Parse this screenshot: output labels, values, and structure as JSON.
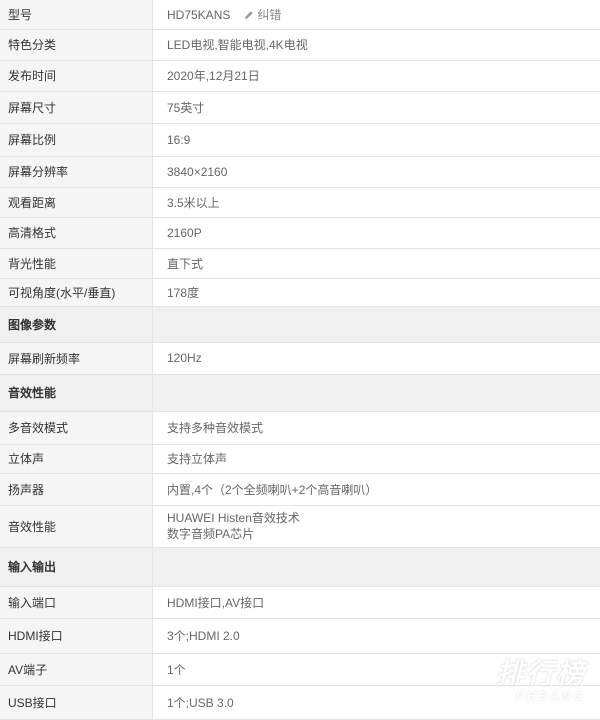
{
  "edit_link": {
    "label": "纠错",
    "icon": "pencil-icon"
  },
  "rows": [
    {
      "type": "row",
      "key": "型号",
      "values": [
        "HD75KANS"
      ],
      "edit": true
    },
    {
      "type": "row",
      "key": "特色分类",
      "values": [
        "LED电视,智能电视,4K电视"
      ]
    },
    {
      "type": "row",
      "key": "发布时间",
      "values": [
        "2020年,12月21日"
      ]
    },
    {
      "type": "row",
      "key": "屏幕尺寸",
      "values": [
        "75英寸"
      ]
    },
    {
      "type": "row",
      "key": "屏幕比例",
      "values": [
        "16:9"
      ]
    },
    {
      "type": "row",
      "key": "屏幕分辨率",
      "values": [
        "3840×2160"
      ]
    },
    {
      "type": "row",
      "key": "观看距离",
      "values": [
        "3.5米以上"
      ]
    },
    {
      "type": "row",
      "key": "高清格式",
      "values": [
        "2160P"
      ]
    },
    {
      "type": "row",
      "key": "背光性能",
      "values": [
        "直下式"
      ]
    },
    {
      "type": "row",
      "key": "可视角度(水平/垂直)",
      "values": [
        "178度"
      ]
    },
    {
      "type": "section",
      "key": "图像参数"
    },
    {
      "type": "row",
      "key": "屏幕刷新频率",
      "values": [
        "120Hz"
      ]
    },
    {
      "type": "section",
      "key": "音效性能"
    },
    {
      "type": "row",
      "key": "多音效模式",
      "values": [
        "支持多种音效模式"
      ]
    },
    {
      "type": "row",
      "key": "立体声",
      "values": [
        "支持立体声"
      ]
    },
    {
      "type": "row",
      "key": "扬声器",
      "values": [
        "内置,4个（2个全频喇叭+2个高音喇叭）"
      ]
    },
    {
      "type": "row",
      "key": "音效性能",
      "values": [
        "HUAWEI Histen音效技术",
        "数字音频PA芯片"
      ]
    },
    {
      "type": "section",
      "key": "输入输出"
    },
    {
      "type": "row",
      "key": "输入端口",
      "values": [
        "HDMI接口,AV接口"
      ]
    },
    {
      "type": "row",
      "key": "HDMI接口",
      "values": [
        "3个;HDMI 2.0"
      ]
    },
    {
      "type": "row",
      "key": "AV端子",
      "values": [
        "1个"
      ]
    },
    {
      "type": "row",
      "key": "USB接口",
      "values": [
        "1个;USB 3.0"
      ]
    }
  ],
  "watermark": {
    "cn": "排行榜",
    "en": "PHBANG"
  }
}
